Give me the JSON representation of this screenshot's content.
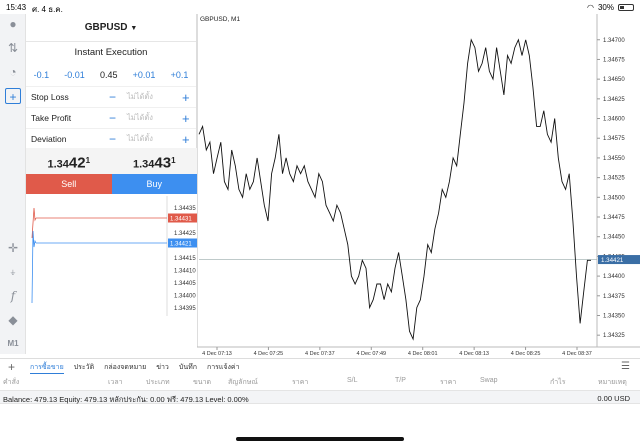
{
  "status": {
    "time": "15:43",
    "date": "ศ. 4 ธ.ค.",
    "battery": "30%"
  },
  "order": {
    "symbol": "GBPUSD",
    "execution": "Instant Execution",
    "volume": {
      "steps": [
        "-0.1",
        "-0.01",
        "+0.01",
        "+0.1"
      ],
      "value": "0.45"
    },
    "params": [
      {
        "label": "Stop Loss",
        "value": "ไม่ได้ตั้ง"
      },
      {
        "label": "Take Profit",
        "value": "ไม่ได้ตั้ง"
      },
      {
        "label": "Deviation",
        "value": "ไม่ได้ตั้ง"
      }
    ],
    "bid": {
      "prefix": "1.34",
      "big": "42",
      "sup": "1"
    },
    "ask": {
      "prefix": "1.34",
      "big": "43",
      "sup": "1"
    },
    "sell_label": "Sell",
    "buy_label": "Buy"
  },
  "mini_chart": {
    "ticks": [
      "1.34435",
      "1.34430",
      "1.34425",
      "1.34420",
      "1.34415",
      "1.34410",
      "1.34405",
      "1.34400",
      "1.34395"
    ],
    "ask_label": "1.34431",
    "bid_label": "1.34421",
    "ask_color": "#e05a4a",
    "bid_color": "#3d8ff0"
  },
  "chart_data": {
    "type": "line",
    "title": "GBPUSD, M1",
    "y_ticks": [
      "1.34700",
      "1.34675",
      "1.34650",
      "1.34625",
      "1.34600",
      "1.34575",
      "1.34550",
      "1.34525",
      "1.34500",
      "1.34475",
      "1.34450",
      "1.34425",
      "1.34400",
      "1.34375",
      "1.34350",
      "1.34325"
    ],
    "x_ticks": [
      "4 Dec 07:13",
      "4 Dec 07:25",
      "4 Dec 07:37",
      "4 Dec 07:49",
      "4 Dec 08:01",
      "4 Dec 08:13",
      "4 Dec 08:25",
      "4 Dec 08:37"
    ],
    "ylim": [
      1.3431,
      1.3472
    ],
    "current_price_label": "1.34421",
    "current_price": 1.34421,
    "values": [
      1.3458,
      1.3459,
      1.3456,
      1.3457,
      1.3453,
      1.3455,
      1.3457,
      1.3452,
      1.3451,
      1.3456,
      1.3454,
      1.3451,
      1.345,
      1.3453,
      1.3451,
      1.3452,
      1.3455,
      1.3452,
      1.3449,
      1.3447,
      1.3453,
      1.3455,
      1.3458,
      1.3453,
      1.3455,
      1.3453,
      1.3452,
      1.3454,
      1.3453,
      1.3454,
      1.3452,
      1.3451,
      1.345,
      1.3453,
      1.3452,
      1.3449,
      1.3448,
      1.3447,
      1.3449,
      1.3448,
      1.3446,
      1.3444,
      1.344,
      1.3439,
      1.344,
      1.3442,
      1.3441,
      1.3436,
      1.3437,
      1.3439,
      1.3439,
      1.3437,
      1.3439,
      1.3438,
      1.3441,
      1.3443,
      1.344,
      1.3437,
      1.3433,
      1.3432,
      1.3436,
      1.3437,
      1.344,
      1.3444,
      1.3443,
      1.3446,
      1.3448,
      1.3451,
      1.345,
      1.3452,
      1.3455,
      1.3454,
      1.3458,
      1.3462,
      1.3467,
      1.347,
      1.3469,
      1.3466,
      1.3467,
      1.3469,
      1.3466,
      1.3465,
      1.3469,
      1.3466,
      1.3463,
      1.3468,
      1.3467,
      1.3469,
      1.347,
      1.3468,
      1.347,
      1.3468,
      1.3464,
      1.3459,
      1.3459,
      1.3461,
      1.3458,
      1.3457,
      1.346,
      1.3455,
      1.3452,
      1.3451,
      1.3453,
      1.3447,
      1.344,
      1.3434,
      1.3438,
      1.3442,
      1.3442
    ]
  },
  "toolbox": {
    "tabs": [
      "การซื้อขาย",
      "ประวัติ",
      "กล่องจดหมาย",
      "ข่าว",
      "บันทึก",
      "การแจ้งค่า"
    ],
    "columns": [
      "คำสั่ง",
      "เวลา",
      "ประเภท",
      "ขนาด",
      "สัญลักษณ์",
      "ราคา",
      "S/L",
      "T/P",
      "ราคา",
      "Swap",
      "กำไร",
      "หมายเหตุ"
    ],
    "balance_text": "Balance: 479.13 Equity: 479.13 หลักประกัน: 0.00 ฟรี: 479.13 Level: 0.00%",
    "balance_amount": "0.00",
    "currency": "USD"
  },
  "rail": {
    "timeframe": "M1"
  }
}
